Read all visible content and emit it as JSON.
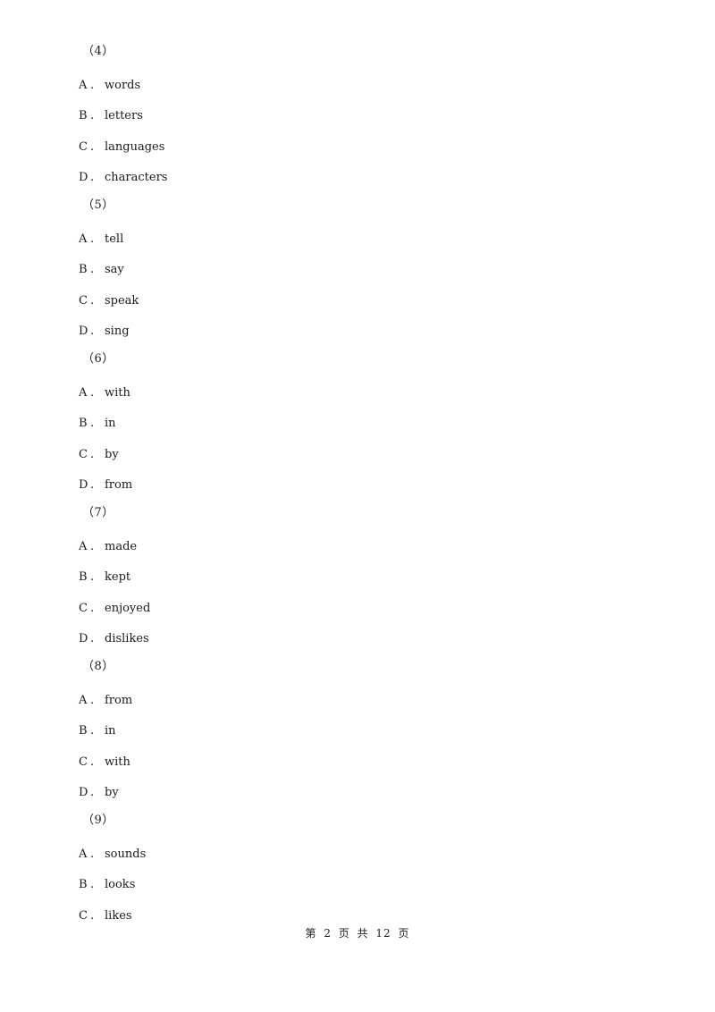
{
  "questions": [
    {
      "number": "（4）",
      "options": [
        {
          "letter": "A",
          "text": "words"
        },
        {
          "letter": "B",
          "text": "letters"
        },
        {
          "letter": "C",
          "text": "languages"
        },
        {
          "letter": "D",
          "text": "characters"
        }
      ]
    },
    {
      "number": "（5）",
      "options": [
        {
          "letter": "A",
          "text": "tell"
        },
        {
          "letter": "B",
          "text": "say"
        },
        {
          "letter": "C",
          "text": "speak"
        },
        {
          "letter": "D",
          "text": "sing"
        }
      ]
    },
    {
      "number": "（6）",
      "options": [
        {
          "letter": "A",
          "text": "with"
        },
        {
          "letter": "B",
          "text": "in"
        },
        {
          "letter": "C",
          "text": "by"
        },
        {
          "letter": "D",
          "text": "from"
        }
      ]
    },
    {
      "number": "（7）",
      "options": [
        {
          "letter": "A",
          "text": "made"
        },
        {
          "letter": "B",
          "text": "kept"
        },
        {
          "letter": "C",
          "text": "enjoyed"
        },
        {
          "letter": "D",
          "text": "dislikes"
        }
      ]
    },
    {
      "number": "（8）",
      "options": [
        {
          "letter": "A",
          "text": "from"
        },
        {
          "letter": "B",
          "text": "in"
        },
        {
          "letter": "C",
          "text": "with"
        },
        {
          "letter": "D",
          "text": "by"
        }
      ]
    },
    {
      "number": "（9）",
      "options": [
        {
          "letter": "A",
          "text": "sounds"
        },
        {
          "letter": "B",
          "text": "looks"
        },
        {
          "letter": "C",
          "text": "likes"
        }
      ]
    }
  ],
  "dot": ".",
  "footer": "第 2 页 共 12 页"
}
